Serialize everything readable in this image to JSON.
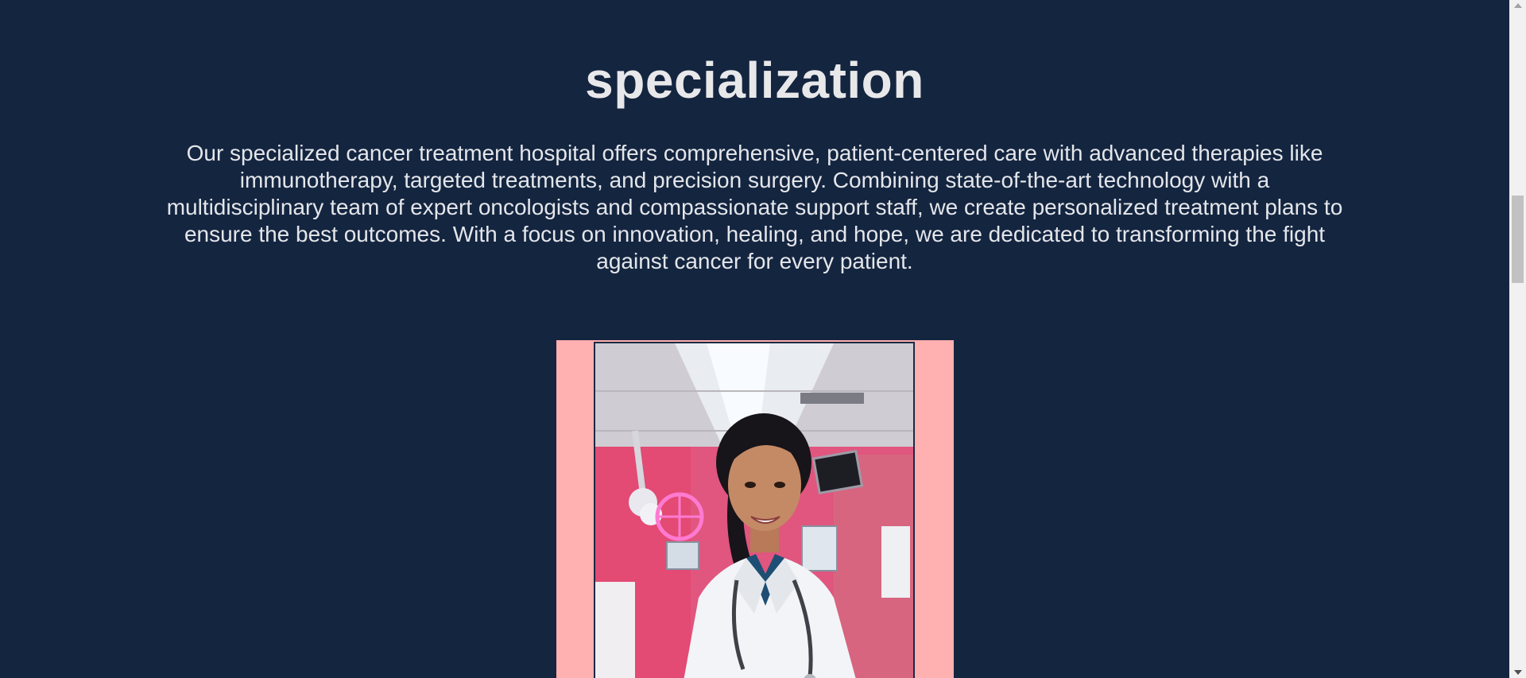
{
  "section": {
    "title": "specialization",
    "description": "Our specialized cancer treatment hospital offers comprehensive, patient-centered care with advanced therapies like immunotherapy, targeted treatments, and precision surgery. Combining state-of-the-art technology with a multidisciplinary team of expert oncologists and compassionate support staff, we create personalized treatment plans to ensure the best outcomes. With a focus on innovation, healing, and hope, we are dedicated to transforming the fight against cancer for every patient."
  },
  "image": {
    "alt": "Smiling female doctor in a white coat with stethoscope in a hospital room",
    "frame_color": "#ffb0b0"
  },
  "colors": {
    "background": "#142540",
    "text": "#e4e6ea"
  }
}
